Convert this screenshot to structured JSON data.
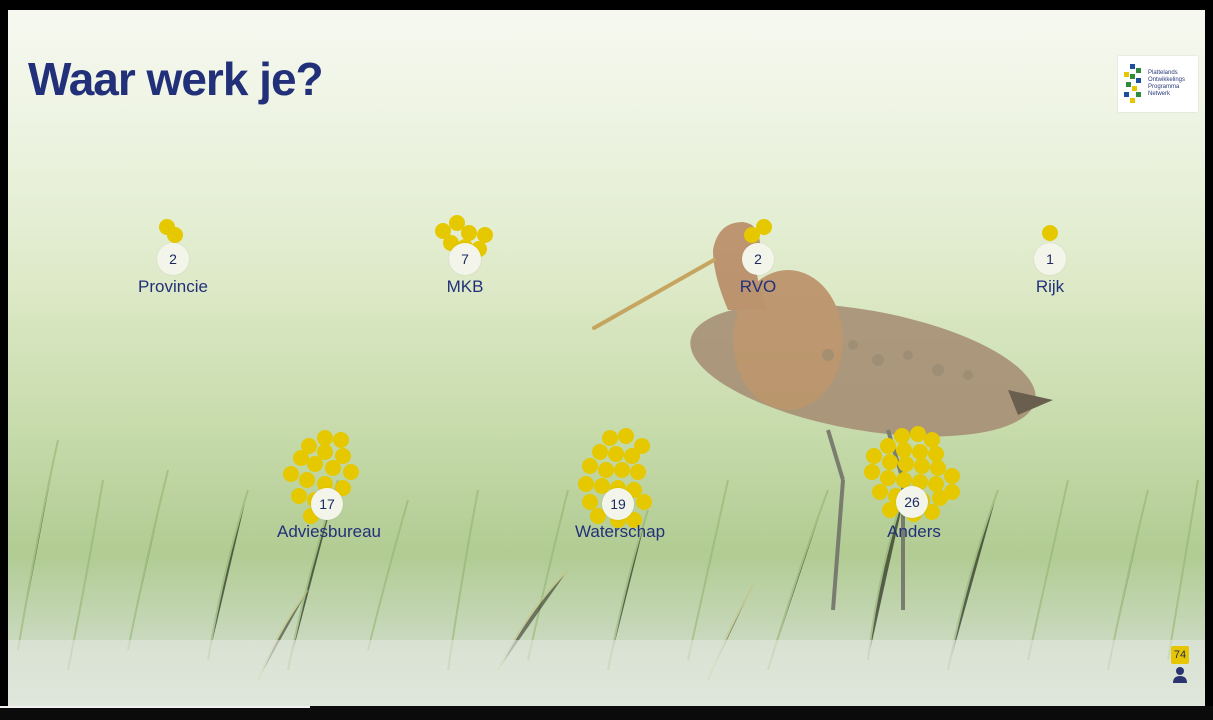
{
  "title": "Waar werk je?",
  "logo": {
    "text": "Plattelands\nOntwikkelings\nProgramma\nNetwerk"
  },
  "groups": [
    {
      "label": "Provincie",
      "count": "2"
    },
    {
      "label": "MKB",
      "count": "7"
    },
    {
      "label": "RVO",
      "count": "2"
    },
    {
      "label": "Rijk",
      "count": "1"
    },
    {
      "label": "Adviesbureau",
      "count": "17"
    },
    {
      "label": "Waterschap",
      "count": "19"
    },
    {
      "label": "Anders",
      "count": "26"
    }
  ],
  "participants": {
    "count": "74",
    "icon": "person-icon"
  },
  "colors": {
    "dot": "#e5c800",
    "title": "#22307a"
  }
}
